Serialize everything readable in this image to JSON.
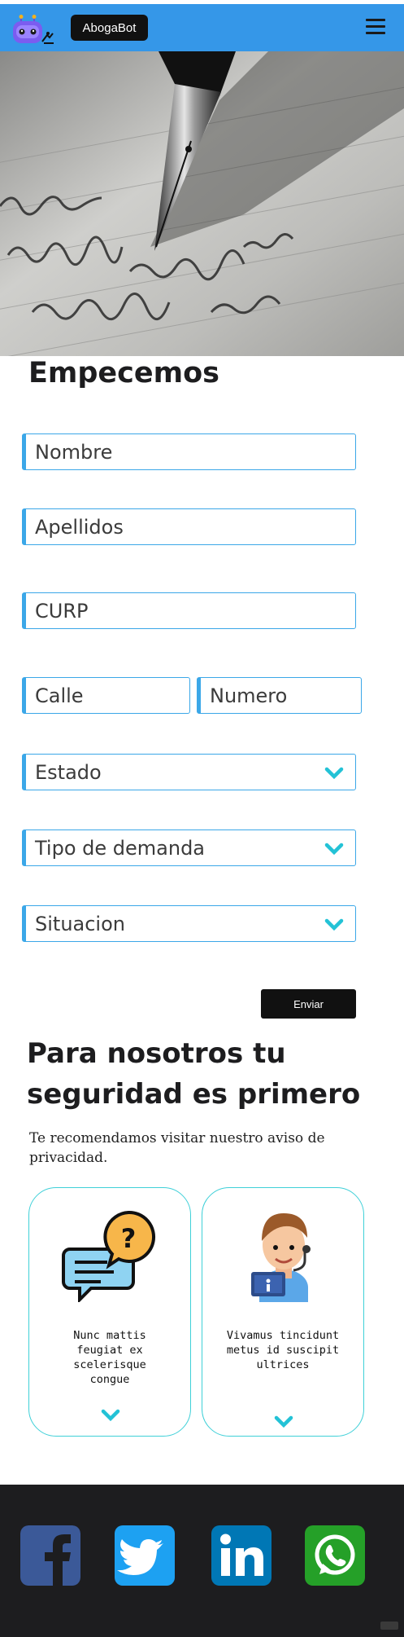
{
  "header": {
    "brand": "AbogaBot",
    "logo_icon": "robot-icon",
    "menu_icon": "hamburger-icon",
    "color": "#3597e8"
  },
  "form": {
    "title": "Empecemos",
    "nombre_placeholder": "Nombre",
    "apellidos_placeholder": "Apellidos",
    "curp_placeholder": "CURP",
    "calle_placeholder": "Calle",
    "numero_placeholder": "Numero",
    "estado_label": "Estado",
    "tipo_label": "Tipo de demanda",
    "situacion_label": "Situacion",
    "submit_label": "Enviar",
    "field_border_color": "#3ba7e8",
    "chevron_color": "#23c2d6"
  },
  "security": {
    "title": "Para nosotros tu seguridad es primero",
    "text": "Te recomendamos visitar nuestro aviso de privacidad.",
    "cards": [
      {
        "icon": "faq-chat-icon",
        "text": "Nunc mattis\nfeugiat ex\nscelerisque\ncongue"
      },
      {
        "icon": "support-agent-icon",
        "text": "Vivamus tincidunt\nmetus id suscipit\nultrices"
      }
    ],
    "card_border_color": "#3fd0d8"
  },
  "footer": {
    "social": [
      {
        "icon": "facebook-icon",
        "color": "#3b5998"
      },
      {
        "icon": "twitter-icon",
        "color": "#1da1f2"
      },
      {
        "icon": "linkedin-icon",
        "color": "#0077b5"
      },
      {
        "icon": "whatsapp-icon",
        "color": "#25a028"
      }
    ]
  }
}
